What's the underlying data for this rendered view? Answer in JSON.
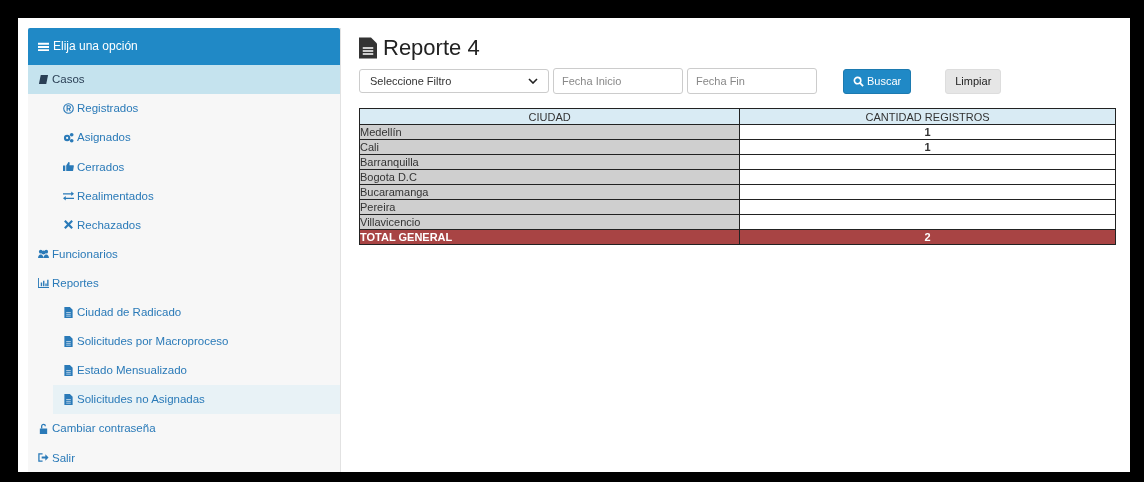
{
  "menu": {
    "title": "Elija una opción",
    "items": [
      {
        "label": "Casos",
        "selected": true,
        "children": [
          {
            "label": "Registrados",
            "selected": false
          },
          {
            "label": "Asignados",
            "selected": false
          },
          {
            "label": "Cerrados",
            "selected": false
          },
          {
            "label": "Realimentados",
            "selected": false
          },
          {
            "label": "Rechazados",
            "selected": false
          }
        ]
      },
      {
        "label": "Funcionarios",
        "selected": false
      },
      {
        "label": "Reportes",
        "selected": false,
        "children": [
          {
            "label": "Ciudad de Radicado",
            "selected": false
          },
          {
            "label": "Solicitudes por Macroproceso",
            "selected": false
          },
          {
            "label": "Estado Mensualizado",
            "selected": false
          },
          {
            "label": "Solicitudes no Asignadas",
            "selected": true
          }
        ]
      },
      {
        "label": "Cambiar contraseña",
        "selected": false
      },
      {
        "label": "Salir",
        "selected": false
      }
    ]
  },
  "page": {
    "title": "Reporte 4"
  },
  "filters": {
    "select": {
      "value": "Seleccione Filtro"
    },
    "start_date": {
      "placeholder": "Fecha Inicio"
    },
    "end_date": {
      "placeholder": "Fecha Fin"
    },
    "buttons": [
      {
        "label": "Buscar",
        "kind": "primary"
      },
      {
        "label": "Limpiar",
        "kind": "default"
      }
    ]
  },
  "table": {
    "columns": [
      "CIUDAD",
      "CANTIDAD REGISTROS"
    ],
    "rows": [
      {
        "kind": "data",
        "city": "Medellín",
        "count": "1"
      },
      {
        "kind": "data",
        "city": "Cali",
        "count": "1"
      },
      {
        "kind": "data",
        "city": "Barranquilla"
      },
      {
        "kind": "data",
        "city": "Bogota D.C"
      },
      {
        "kind": "data",
        "city": "Bucaramanga"
      },
      {
        "kind": "data",
        "city": "Pereira"
      },
      {
        "kind": "data",
        "city": "Villavicencio"
      },
      {
        "kind": "total",
        "city": "TOTAL GENERAL",
        "count": "2"
      }
    ]
  }
}
